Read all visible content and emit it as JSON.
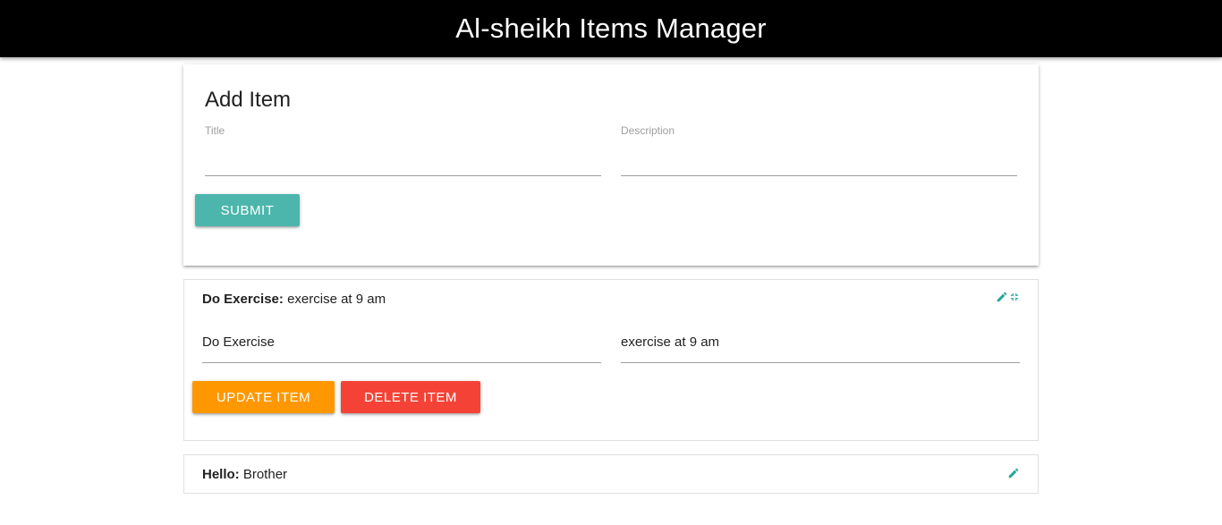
{
  "app": {
    "title": "Al-sheikh Items Manager"
  },
  "add_form": {
    "title": "Add Item",
    "title_label": "Title",
    "description_label": "Description",
    "title_value": "",
    "description_value": "",
    "submit_label": "SUBMIT"
  },
  "items": [
    {
      "title": "Do Exercise:",
      "description": "exercise at 9 am",
      "edit_title_value": "Do Exercise",
      "edit_description_value": "exercise at 9 am",
      "update_label": "UPDATE ITEM",
      "delete_label": "DELETE ITEM",
      "icons": [
        "pencil-icon",
        "collapse-icon"
      ]
    },
    {
      "title": "Hello:",
      "description": "Brother",
      "icons": [
        "pencil-icon"
      ]
    }
  ],
  "colors": {
    "navbar": "#000000",
    "accent": "#26a69a",
    "submit": "#4db6ac",
    "update": "#ff9800",
    "delete": "#f44336"
  }
}
